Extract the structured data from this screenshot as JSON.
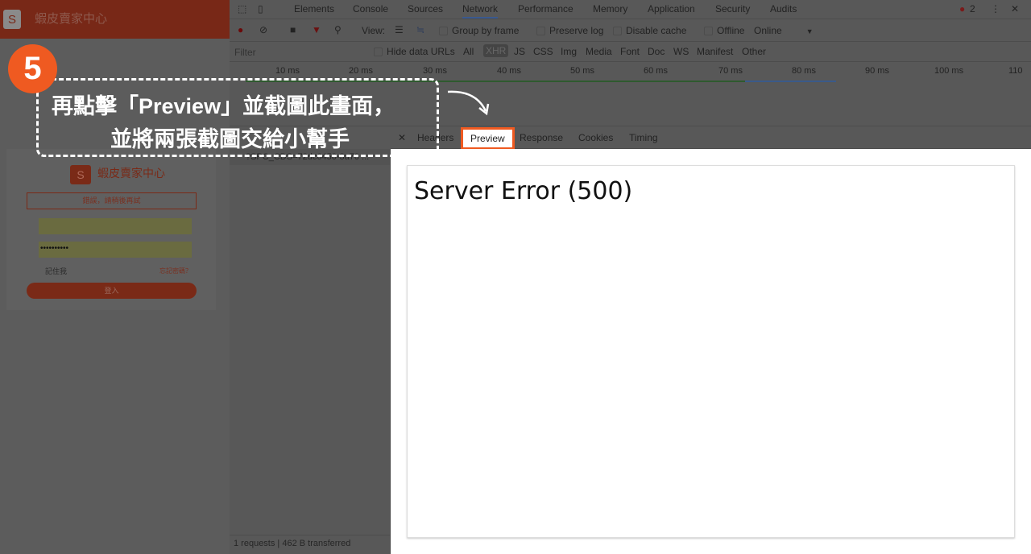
{
  "page": {
    "brand": "蝦皮賣家中心",
    "logo_letter": "S",
    "error": "錯誤，請稍後再試",
    "password_mask": "••••••••••",
    "remember": "記住我",
    "forgot": "忘記密碼？",
    "login": "登入"
  },
  "devtools": {
    "tabs": [
      "Elements",
      "Console",
      "Sources",
      "Network",
      "Performance",
      "Memory",
      "Application",
      "Security",
      "Audits"
    ],
    "active_tab": "Network",
    "error_count": "2",
    "toolbar": {
      "view": "View:",
      "group_by_frame": "Group by frame",
      "preserve_log": "Preserve log",
      "disable_cache": "Disable cache",
      "offline": "Offline",
      "throttle": "Online"
    },
    "filter": {
      "placeholder": "Filter",
      "hide_data_urls": "Hide data URLs",
      "types": [
        "All",
        "XHR",
        "JS",
        "CSS",
        "Img",
        "Media",
        "Font",
        "Doc",
        "WS",
        "Manifest",
        "Other"
      ],
      "active_type": "XHR"
    },
    "timeline": [
      "10 ms",
      "20 ms",
      "30 ms",
      "40 ms",
      "50 ms",
      "60 ms",
      "70 ms",
      "80 ms",
      "90 ms",
      "100 ms",
      "110"
    ],
    "request": "?SPC_CDS=72dc6450-3a70 ...",
    "detail_tabs": [
      "Headers",
      "Preview",
      "Response",
      "Cookies",
      "Timing"
    ],
    "active_detail_tab": "Preview",
    "preview_text": "Server Error (500)",
    "status": "1 requests | 462 B transferred"
  },
  "callout": {
    "step": "5",
    "line1": "再點擊「Preview」並截圖此畫面，",
    "line2": "並將兩張截圖交給小幫手",
    "accent": "#ef5a21"
  }
}
